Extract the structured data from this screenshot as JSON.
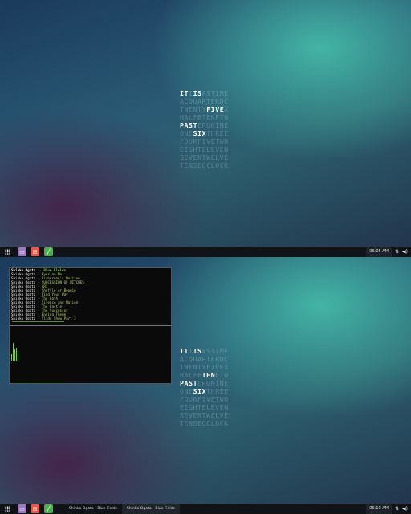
{
  "clock_rows": [
    [
      "IT",
      " ",
      "IS",
      " ",
      "A",
      "S",
      "T",
      "I",
      "M",
      "E"
    ],
    [
      "ACQUARTERDC"
    ],
    [
      "TWENTY",
      "FIVE",
      "X"
    ],
    [
      "HALFBTENFTO"
    ],
    [
      "PAST",
      "ERUNINE"
    ],
    [
      "ONE",
      "SIX",
      "THREE"
    ],
    [
      "FOURFIVETWO"
    ],
    [
      "EIGHTELEVEN"
    ],
    [
      "SEVENTWELVE"
    ],
    [
      "TENSEOCLOCK"
    ]
  ],
  "top": {
    "clock": {
      "r0": {
        "a": "IT",
        "b": "I",
        "c": "IS",
        "d": "ASTIME"
      },
      "r1": "ACQUARTERDC",
      "r2": {
        "a": "TWENTY",
        "b": "FIVE",
        "c": "X"
      },
      "r3": "HALFBTENFTO",
      "r4": {
        "a": "PAST",
        "b": "ERUNINE"
      },
      "r5": {
        "a": "ONE",
        "b": "SIX",
        "c": "THREE"
      },
      "r6": "FOURFIVETWO",
      "r7": "EIGHTELEVEN",
      "r8": "SEVENTWELVE",
      "r9": "TENSEOCLOCK"
    },
    "time": "06:05 AM"
  },
  "bottom": {
    "clock": {
      "r0": {
        "a": "IT",
        "b": "I",
        "c": "IS",
        "d": "ASTIME"
      },
      "r1": "ACQUARTERDC",
      "r2": "TWENTYFIVEX",
      "r3": {
        "a": "HALFB",
        "b": "TEN",
        "c": "FTO"
      },
      "r4": {
        "a": "PAST",
        "b": "ERUNINE"
      },
      "r5": {
        "a": "ONE",
        "b": "SIX",
        "c": "THREE"
      },
      "r6": "FOURFIVETWO",
      "r7": "EIGHTELEVEN",
      "r8": "SEVENTWELVE",
      "r9": "TENSEOCLOCK"
    },
    "time": "06:10 AM",
    "tasks": [
      "Shinko Ogata - Blue Fields",
      "Shinko Ogata - Blue Fields"
    ],
    "terminal": {
      "header": {
        "artist": "Shinko Ogata",
        "sep": " -- ",
        "title": "Blue Fields"
      },
      "tracks": [
        {
          "artist": "Shinko Ogata",
          "title": "Eyes on Me"
        },
        {
          "artist": "Shinko Ogata",
          "title": "Fisherman's Horizon"
        },
        {
          "artist": "Shinko Ogata",
          "title": "SUCCESSION OF WITCHES"
        },
        {
          "artist": "Shinko Ogata",
          "title": "ARI"
        },
        {
          "artist": "Shinko Ogata",
          "title": "Shuffle or Boogie"
        },
        {
          "artist": "Shinko Ogata",
          "title": "Find Your Way"
        },
        {
          "artist": "Shinko Ogata",
          "title": "The Oath"
        },
        {
          "artist": "Shinko Ogata",
          "title": "Silence and Motion"
        },
        {
          "artist": "Shinko Ogata",
          "title": "The Castle"
        },
        {
          "artist": "Shinko Ogata",
          "title": "The Successor"
        },
        {
          "artist": "Shinko Ogata",
          "title": "Ending Theme"
        },
        {
          "artist": "Shinko Ogata",
          "title": "Slide Show Part 2"
        }
      ],
      "sep": " - "
    }
  },
  "colors": {
    "accent_green": "#7ec04b",
    "taskbar": "#101418"
  }
}
